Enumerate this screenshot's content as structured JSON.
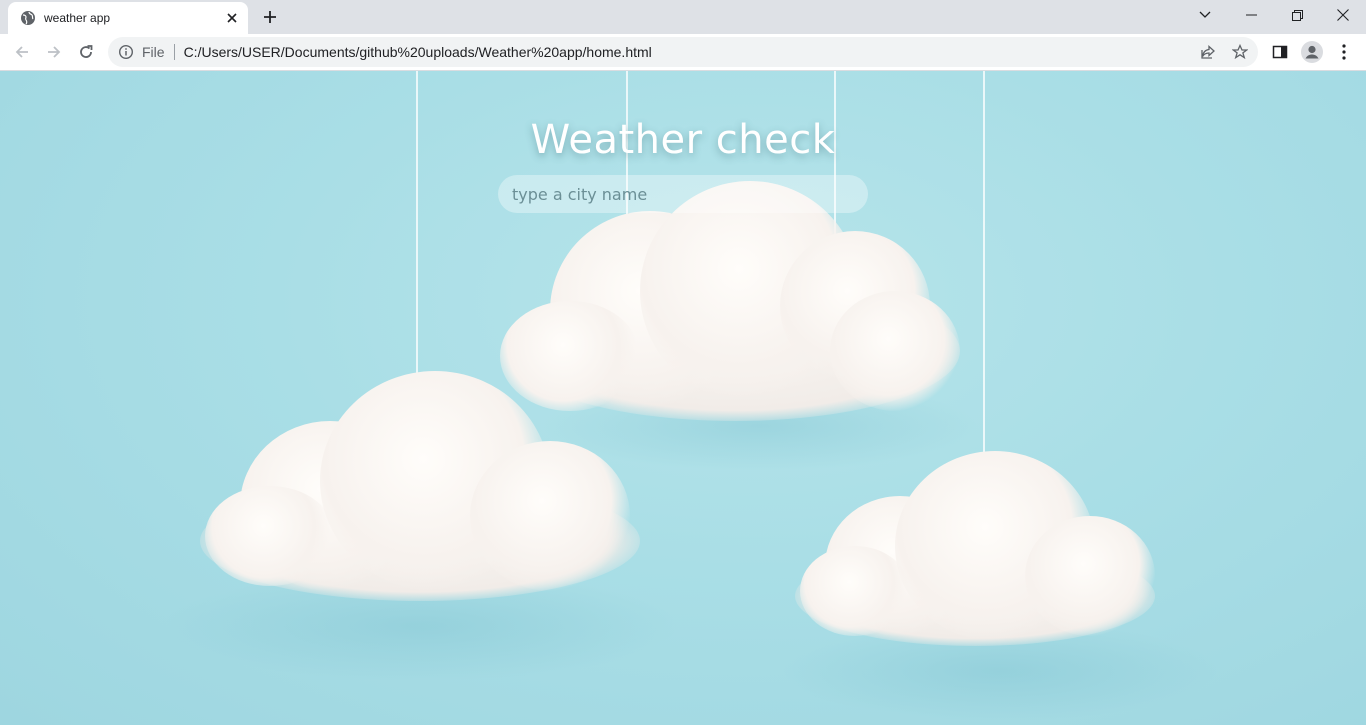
{
  "browser": {
    "tab": {
      "title": "weather app",
      "favicon": "globe-icon",
      "close_icon": "close-icon"
    },
    "new_tab_icon": "plus-icon",
    "window_controls": [
      "chevron-down-icon",
      "minimize-icon",
      "restore-icon",
      "close-icon"
    ],
    "nav": [
      "back-arrow-icon",
      "forward-arrow-icon",
      "reload-icon"
    ],
    "address": {
      "scheme_label": "File",
      "url": "C:/Users/USER/Documents/github%20uploads/Weather%20app/home.html"
    },
    "toolbar_icons": [
      "share-icon",
      "star-icon",
      "side-panel-icon",
      "profile-icon",
      "kebab-menu-icon"
    ]
  },
  "page": {
    "title": "Weather check",
    "search": {
      "placeholder": "type a city name",
      "value": ""
    },
    "background_color": "#a9dee6"
  }
}
